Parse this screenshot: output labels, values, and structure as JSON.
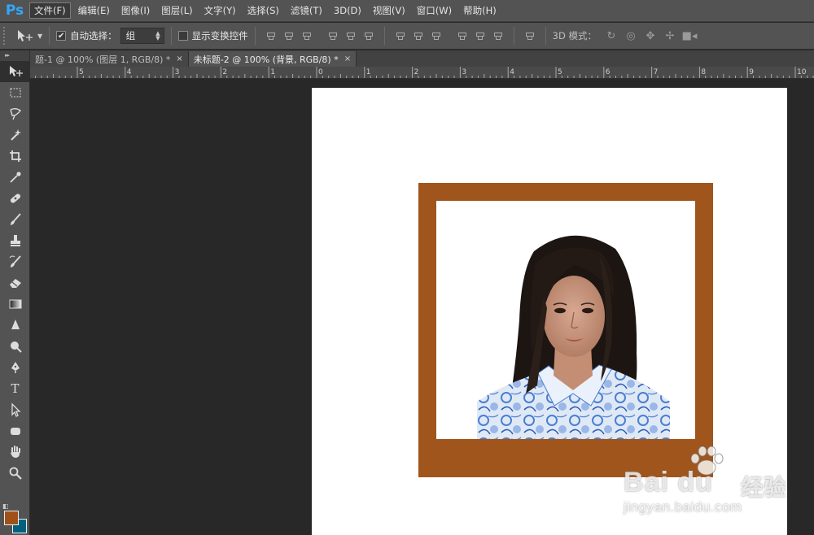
{
  "app": {
    "logo": "Ps"
  },
  "menu": [
    {
      "label": "文件(F)",
      "active": true
    },
    {
      "label": "编辑(E)"
    },
    {
      "label": "图像(I)"
    },
    {
      "label": "图层(L)"
    },
    {
      "label": "文字(Y)"
    },
    {
      "label": "选择(S)"
    },
    {
      "label": "滤镜(T)"
    },
    {
      "label": "3D(D)"
    },
    {
      "label": "视图(V)"
    },
    {
      "label": "窗口(W)"
    },
    {
      "label": "帮助(H)"
    }
  ],
  "options": {
    "auto_select_label": "自动选择：",
    "auto_select_checked": true,
    "auto_select_value": "组",
    "show_transform_label": "显示变换控件",
    "show_transform_checked": false,
    "mode_label": "3D 模式："
  },
  "toolbar": {
    "collapse_glyph": "▸▸",
    "tools": [
      "move-tool",
      "marquee-tool",
      "lasso-tool",
      "magic-wand-tool",
      "crop-tool",
      "eyedropper-tool",
      "healing-brush-tool",
      "brush-tool",
      "clone-stamp-tool",
      "history-brush-tool",
      "eraser-tool",
      "gradient-tool",
      "blur-tool",
      "dodge-tool",
      "pen-tool",
      "type-tool",
      "path-selection-tool",
      "rectangle-tool",
      "hand-tool",
      "zoom-tool"
    ],
    "type_glyph": "T",
    "foreground_color": "#a0511a",
    "background_color": "#006080"
  },
  "tabs": [
    {
      "label": "题-1 @ 100% (图层 1, RGB/8) *",
      "active": false,
      "close": "×"
    },
    {
      "label": "未标题-2 @ 100% (背景, RGB/8) *",
      "active": true,
      "close": "×"
    }
  ],
  "ruler": {
    "labels": [
      {
        "text": "5"
      },
      {
        "text": "4"
      },
      {
        "text": "3"
      },
      {
        "text": "2"
      },
      {
        "text": "1"
      },
      {
        "text": "0"
      },
      {
        "text": "1"
      },
      {
        "text": "2"
      },
      {
        "text": "3"
      },
      {
        "text": "4"
      },
      {
        "text": "5"
      },
      {
        "text": "6"
      },
      {
        "text": "7"
      },
      {
        "text": "8"
      },
      {
        "text": "9"
      },
      {
        "text": "10"
      }
    ]
  },
  "canvas": {
    "frame_color": "#a0551c",
    "document_color": "#ffffff"
  },
  "watermark": {
    "brand": "Bai du",
    "brand_cn": "经验",
    "url": "jingyan.baidu.com"
  }
}
